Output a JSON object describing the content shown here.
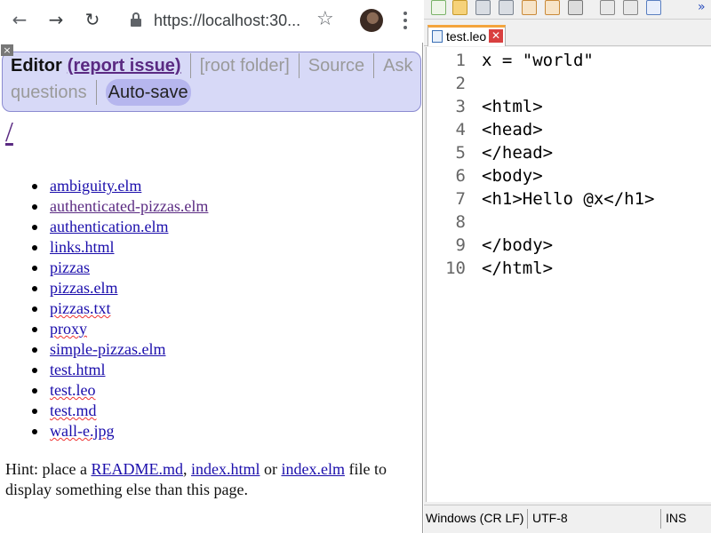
{
  "browser": {
    "url": "https://localhost:30...",
    "icons": [
      "back-arrow-icon",
      "forward-arrow-icon",
      "reload-icon",
      "lock-icon",
      "star-icon",
      "avatar",
      "menu-dots-icon"
    ]
  },
  "editor_bar": {
    "title": "Editor",
    "report_issue": "(report issue)",
    "root_folder": "[root folder]",
    "source": "Source",
    "ask_questions_1": "Ask",
    "ask_questions_2": "questions",
    "auto_save": "Auto-save",
    "close_glyph": "×"
  },
  "page": {
    "heading": "/",
    "files": [
      {
        "name": "ambiguity.elm"
      },
      {
        "name": "authenticated-pizzas.elm"
      },
      {
        "name": "authentication.elm"
      },
      {
        "name": "links.html"
      },
      {
        "name": "pizzas"
      },
      {
        "name": "pizzas.elm"
      },
      {
        "name": "pizzas.txt"
      },
      {
        "name": "proxy"
      },
      {
        "name": "simple-pizzas.elm"
      },
      {
        "name": "test.html"
      },
      {
        "name": "test.leo"
      },
      {
        "name": "test.md"
      },
      {
        "name": "wall-e.jpg"
      }
    ],
    "hint_prefix": "Hint: place a ",
    "hint_readme": "README.md",
    "hint_comma": ", ",
    "hint_index_html": "index.html",
    "hint_or": " or ",
    "hint_index_elm": "index.elm",
    "hint_suffix": " file to display something else than this page."
  },
  "code_editor": {
    "tab_label": "test.leo",
    "tab_close": "✕",
    "overflow": "»",
    "lines": [
      {
        "num": "1",
        "text": "x = \"world\""
      },
      {
        "num": "2",
        "text": ""
      },
      {
        "num": "3",
        "text": "<html>"
      },
      {
        "num": "4",
        "text": "<head>"
      },
      {
        "num": "5",
        "text": "</head>"
      },
      {
        "num": "6",
        "text": "<body>"
      },
      {
        "num": "7",
        "text": "<h1>Hello @x</h1>"
      },
      {
        "num": "8",
        "text": ""
      },
      {
        "num": "9",
        "text": "</body>"
      },
      {
        "num": "10",
        "text": "</html>"
      }
    ],
    "status": {
      "line_endings": "Windows (CR LF)",
      "encoding": "UTF-8",
      "mode": "INS"
    }
  },
  "colors": {
    "editor_bar_bg": "#d7d9f7",
    "auto_save_bg": "#b6b6ee",
    "link": "#1a0dab",
    "visited_link": "#5a2a82",
    "tab_accent": "#f4a43c"
  }
}
